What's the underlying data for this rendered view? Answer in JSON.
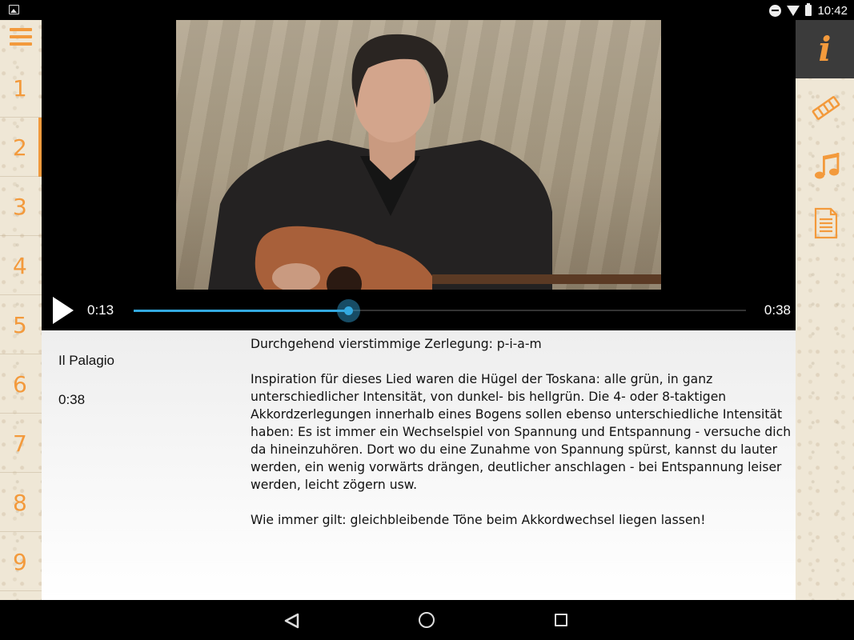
{
  "status_bar": {
    "time": "10:42"
  },
  "left_nav": {
    "items": [
      "1",
      "2",
      "3",
      "4",
      "5",
      "6",
      "7",
      "8",
      "9"
    ],
    "active_index": 1
  },
  "right_nav": {
    "info_label": "i"
  },
  "player": {
    "current_time": "0:13",
    "duration": "0:38",
    "progress": 0.35
  },
  "song": {
    "title": "Il Palagio",
    "duration": "0:38"
  },
  "description": {
    "paragraphs": [
      "Durchgehend vierstimmige Zerlegung: p-i-a-m",
      "Inspiration für dieses Lied waren die Hügel der Toskana: alle grün, in ganz unterschiedlicher Intensität, von dunkel- bis hellgrün. Die 4- oder 8-taktigen Akkordzerlegungen innerhalb eines Bogens sollen ebenso unterschiedliche Intensität haben: Es ist immer ein Wechselspiel von Spannung und Entspannung - versuche dich da hineinzuhören. Dort wo du eine Zunahme von Spannung spürst, kannst du lauter werden, ein wenig vorwärts drängen, deutlicher anschlagen - bei Entspannung leiser werden, leicht zögern usw.",
      "Wie immer gilt: gleichbleibende Töne beim Akkordwechsel liegen lassen!"
    ]
  },
  "colors": {
    "accent": "#f39a3c",
    "seek": "#33a9e0",
    "chrome": "#000000"
  }
}
